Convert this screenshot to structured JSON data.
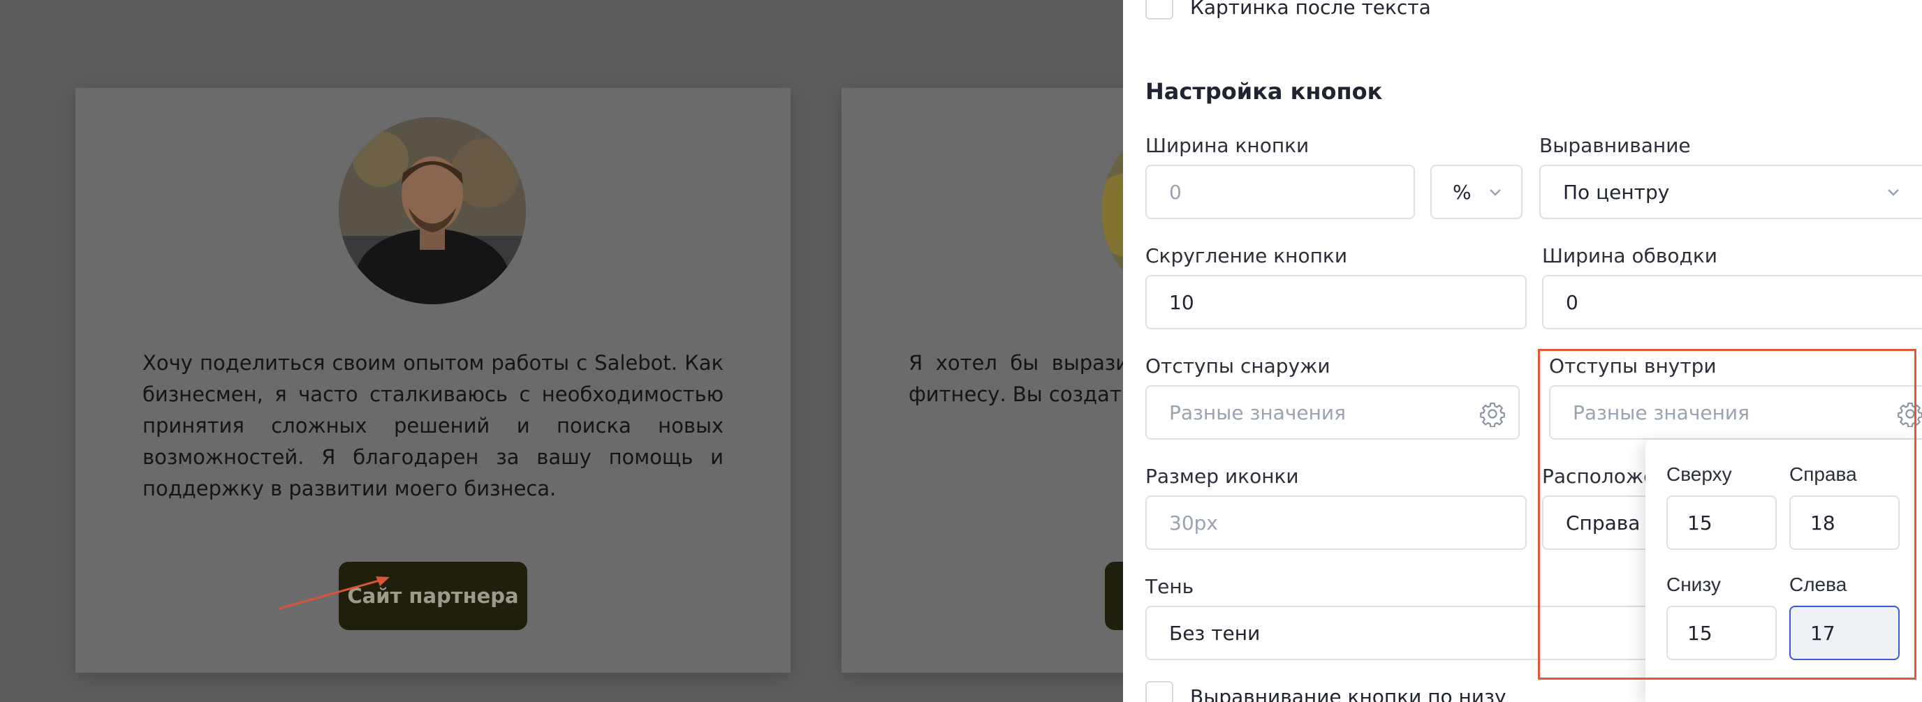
{
  "background": {
    "card1": {
      "testimonial": "Хочу поделиться своим опытом работы с Salebot. Как бизнесмен, я часто сталкиваюсь с необходимостью принятия сложных решений и поиска новых возможностей. Я благодарен за вашу помощь и поддержку в развитии моего бизнеса.",
      "button_label": "Сайт партнера"
    },
    "card2": {
      "testimonial": "Я хотел бы выразить помощь в организа класса по фитнесу. Вы создать интересную участников."
    }
  },
  "panel": {
    "top_checkbox_label": "Картинка после текста",
    "section_title": "Настройка кнопок",
    "button_width": {
      "label": "Ширина кнопки",
      "placeholder": "0",
      "unit": "%"
    },
    "alignment": {
      "label": "Выравнивание",
      "value": "По центру"
    },
    "button_radius": {
      "label": "Скругление кнопки",
      "value": "10"
    },
    "border_width": {
      "label": "Ширина обводки",
      "value": "0"
    },
    "outer_padding": {
      "label": "Отступы снаружи",
      "placeholder": "Разные значения"
    },
    "inner_padding": {
      "label": "Отступы внутри",
      "placeholder": "Разные значения"
    },
    "icon_size": {
      "label": "Размер иконки",
      "placeholder": "30px"
    },
    "icon_position": {
      "label": "Расположе",
      "value": "Справа о"
    },
    "shadow": {
      "label": "Тень",
      "value": "Без тени"
    },
    "bottom_checkbox_label": "Выравнивание кнопки по низу",
    "padding_popover": {
      "top": {
        "label": "Сверху",
        "value": "15"
      },
      "right": {
        "label": "Справа",
        "value": "18"
      },
      "bottom": {
        "label": "Снизу",
        "value": "15"
      },
      "left": {
        "label": "Слева",
        "value": "17"
      }
    }
  },
  "colors": {
    "accent_focus": "#3d57d6",
    "highlight": "#e4543a",
    "button_dark": "#1f1f0c"
  }
}
